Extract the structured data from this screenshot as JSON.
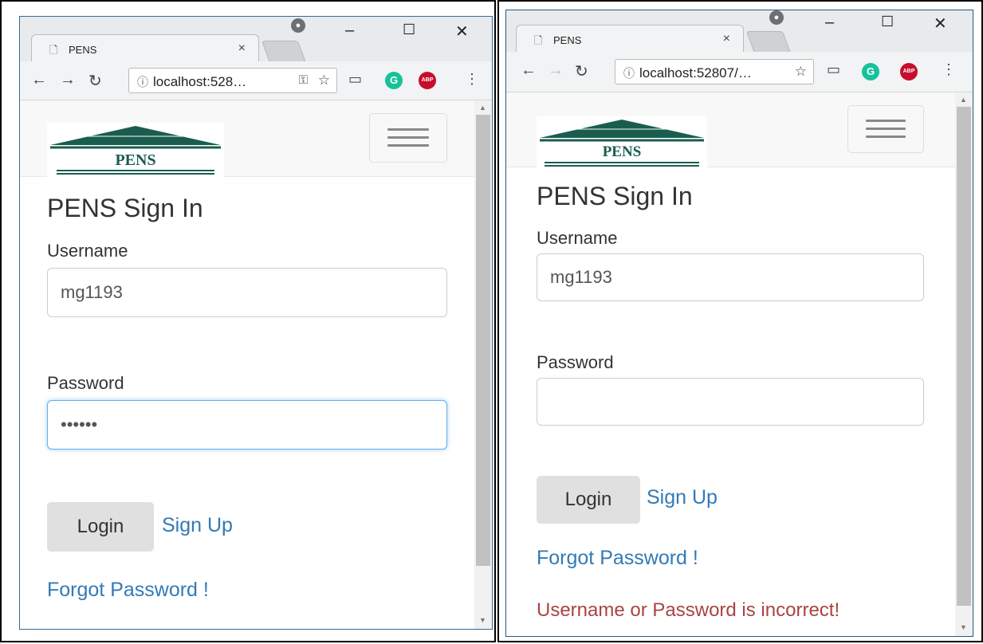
{
  "screens": [
    {
      "tab_title": "PENS",
      "url": "localhost:528…",
      "brand": "PENS",
      "heading": "PENS Sign In",
      "username_label": "Username",
      "username_value": "mg1193",
      "password_label": "Password",
      "password_value": "••••••",
      "login_label": "Login",
      "signup_label": "Sign Up",
      "forgot_label": "Forgot Password !",
      "error_message": ""
    },
    {
      "tab_title": "PENS",
      "url": "localhost:52807/…",
      "brand": "PENS",
      "heading": "PENS Sign In",
      "username_label": "Username",
      "username_value": "mg1193",
      "password_label": "Password",
      "password_value": "",
      "login_label": "Login",
      "signup_label": "Sign Up",
      "forgot_label": "Forgot Password !",
      "error_message": "Username or Password is incorrect!"
    }
  ],
  "icons": {
    "tab": "page-icon",
    "close": "close-icon",
    "back": "back-arrow-icon",
    "forward": "forward-arrow-icon",
    "reload": "reload-icon",
    "info": "info-icon",
    "key": "key-icon",
    "star": "star-icon",
    "cast": "cast-icon",
    "grammarly": "grammarly-icon",
    "adblock": "adblock-icon",
    "menu": "kebab-menu-icon"
  },
  "colors": {
    "brand_green": "#1a5d4f",
    "link": "#337ab7",
    "error": "#a94442",
    "focus": "#66afe9"
  }
}
